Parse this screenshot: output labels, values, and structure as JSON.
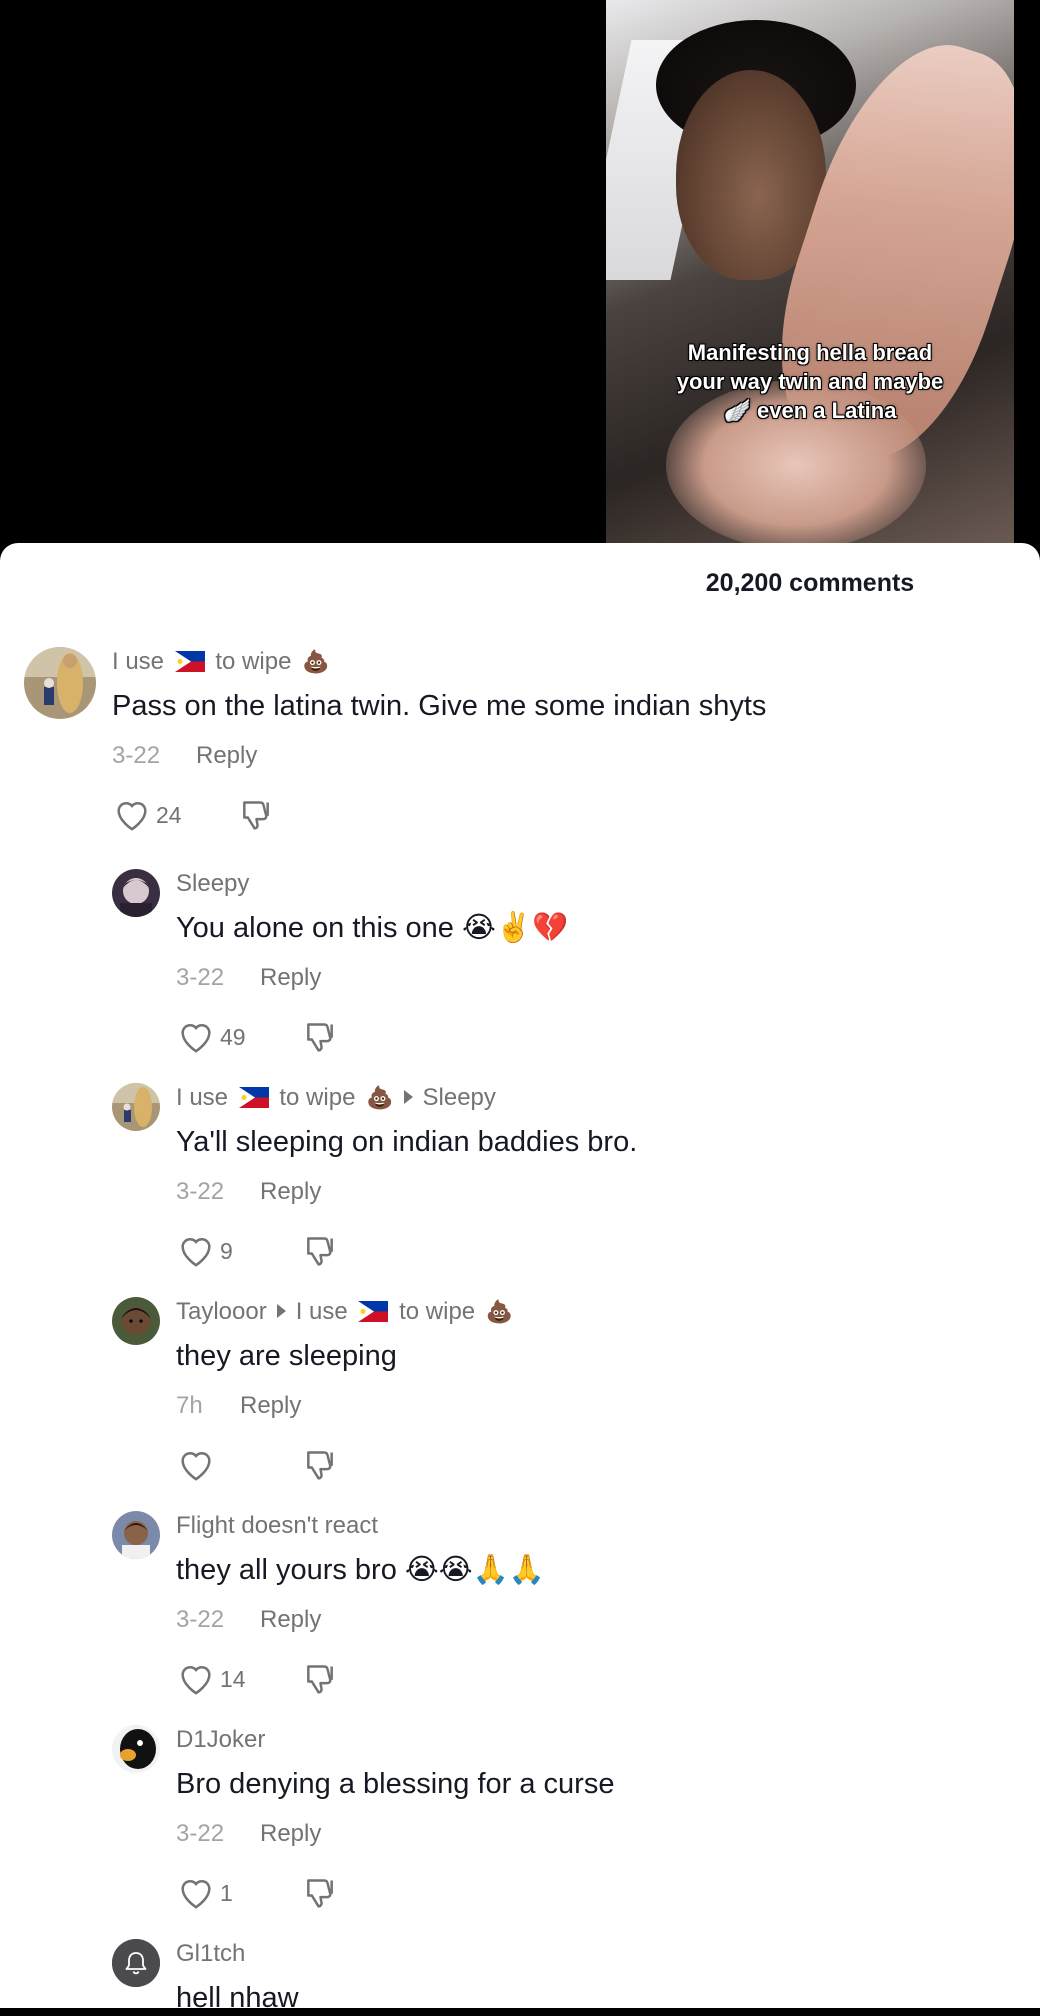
{
  "video": {
    "caption": "Manifesting hella bread your way twin and maybe 🪽 even a Latina"
  },
  "comments_header": "20,200 comments",
  "colors": {
    "text_primary": "#161823",
    "text_secondary": "#737373",
    "text_time": "#a3a3a8"
  },
  "comments": [
    {
      "user": "I use",
      "user_suffix": "to wipe",
      "user_emoji": "💩",
      "reply_to": "",
      "text": "Pass on the latina twin. Give me some indian shyts",
      "time": "3-22",
      "reply_label": "Reply",
      "likes": "24"
    },
    {
      "user": "Sleepy",
      "reply_to": "",
      "text": "You alone on this one 😭✌️💔",
      "time": "3-22",
      "reply_label": "Reply",
      "likes": "49"
    },
    {
      "user": "I use",
      "user_suffix": "to wipe",
      "user_emoji": "💩",
      "reply_to": "Sleepy",
      "text": "Ya'll sleeping on indian baddies bro.",
      "time": "3-22",
      "reply_label": "Reply",
      "likes": "9"
    },
    {
      "user": "Taylooor",
      "reply_to": "I use",
      "reply_to_suffix": "to wipe",
      "reply_to_emoji": "💩",
      "text": "they are sleeping",
      "time": "7h",
      "reply_label": "Reply",
      "likes": ""
    },
    {
      "user": "Flight doesn't react",
      "reply_to": "",
      "text": "they all yours bro 😭😭🙏🙏",
      "time": "3-22",
      "reply_label": "Reply",
      "likes": "14"
    },
    {
      "user": "D1Joker",
      "reply_to": "",
      "text": "Bro denying a blessing for a curse",
      "time": "3-22",
      "reply_label": "Reply",
      "likes": "1"
    },
    {
      "user": "Gl1tch",
      "reply_to": "",
      "text": "hell nhaw"
    }
  ]
}
